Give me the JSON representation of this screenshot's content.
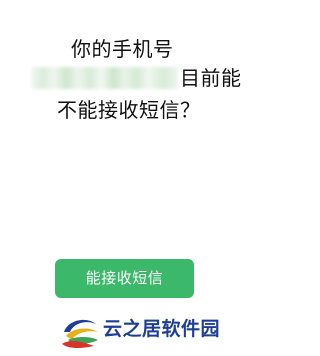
{
  "question": {
    "line1": "你的手机号",
    "line2_suffix": "目前能",
    "line3": "不能接收短信？"
  },
  "confirm_button": {
    "label": "能接收短信",
    "color": "#3cb86a"
  },
  "watermark": {
    "text": "云之居软件园",
    "text_color": "#1f3e98",
    "logo_icon": "swirl-logo-icon"
  }
}
